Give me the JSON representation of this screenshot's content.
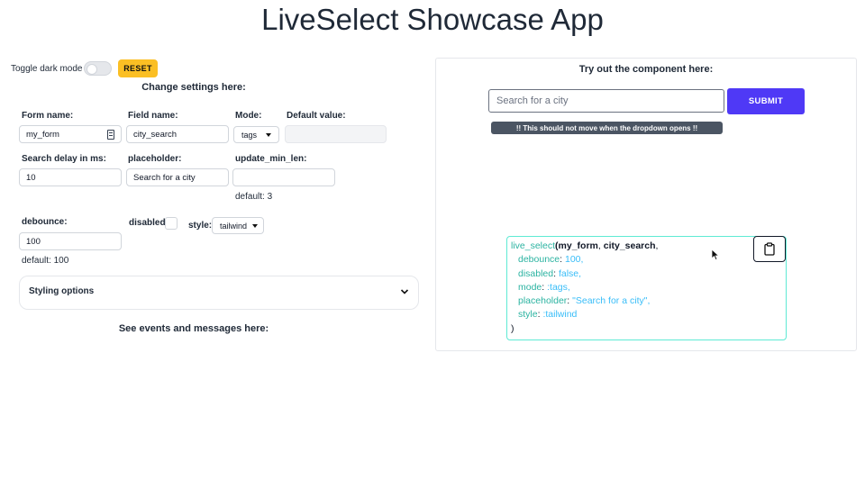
{
  "header": {
    "title": "LiveSelect Showcase App"
  },
  "settings": {
    "toggle_dark_label": "Toggle dark mode",
    "dark_mode_on": false,
    "reset_label": "RESET",
    "heading": "Change settings here:",
    "form_name": {
      "label": "Form name:",
      "value": "my_form"
    },
    "field_name": {
      "label": "Field name:",
      "value": "city_search"
    },
    "mode": {
      "label": "Mode:",
      "value": "tags"
    },
    "default_value": {
      "label": "Default value:",
      "value": ""
    },
    "search_delay": {
      "label": "Search delay in ms:",
      "value": "10"
    },
    "placeholder": {
      "label": "placeholder:",
      "value": "Search for a city"
    },
    "update_min_len": {
      "label": "update_min_len:",
      "value": "",
      "hint": "default: 3"
    },
    "debounce": {
      "label": "debounce:",
      "value": "100",
      "hint": "default: 100"
    },
    "disabled": {
      "label": "disabled:",
      "checked": false
    },
    "style": {
      "label": "style:",
      "value": "tailwind"
    },
    "styling_options_label": "Styling options",
    "events_heading": "See events and messages here:"
  },
  "demo": {
    "heading": "Try out the component here:",
    "search_placeholder": "Search for a city",
    "submit_label": "SUBMIT",
    "warning": "!! This should not move when the dropdown opens !!"
  },
  "code": {
    "fn": "live_select",
    "open_paren": "(",
    "arg1": "my_form",
    "comma1": ", ",
    "arg2": "city_search",
    "comma2": ",",
    "opts": [
      {
        "key": "debounce",
        "value": "100",
        "sep": ","
      },
      {
        "key": "disabled",
        "value": "false",
        "sep": ","
      },
      {
        "key": "mode",
        "value": ":tags",
        "sep": ","
      },
      {
        "key": "placeholder",
        "value": "\"Search for a city\"",
        "sep": ","
      },
      {
        "key": "style",
        "value": ":tailwind",
        "sep": ""
      }
    ],
    "close_paren": ")"
  },
  "colors": {
    "submit": "#4f39f6",
    "reset": "#fbbf24",
    "code_key": "#2bb3a1",
    "code_value": "#38bdf8",
    "code_border": "#5eead4"
  },
  "icons": {
    "copy": "clipboard-icon",
    "expand": "chevron-down-icon",
    "cursor": "mouse-pointer-icon",
    "form_name_suffix": "contact-card-icon"
  }
}
